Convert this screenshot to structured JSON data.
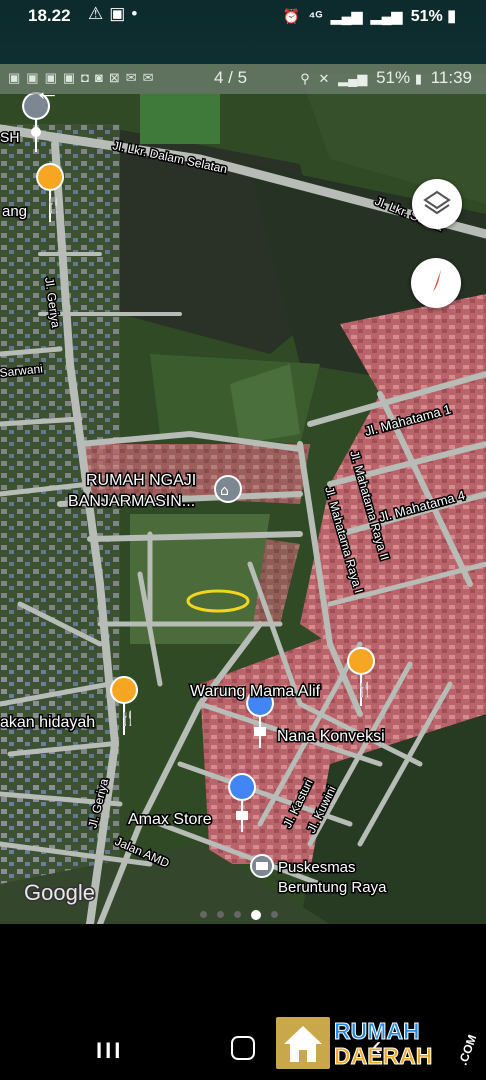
{
  "status_bar": {
    "time": "18.22",
    "left_icons": [
      "warning-icon",
      "image-icon",
      "dot-icon"
    ],
    "right_icons": [
      "alarm-icon",
      "network-4g-icon",
      "signal-icon",
      "signal-icon"
    ],
    "battery": "51%"
  },
  "viewer": {
    "page_counter": "4 / 5",
    "inner_battery": "51%",
    "inner_time": "11:39",
    "page_count": 5,
    "active_page": 4
  },
  "map": {
    "roads": {
      "lkr_dalam_selatan": "Jl. Lkr. Dalam Selatan",
      "lkr_selatan_edge": "Jl. Lkr. Selata",
      "geriya_top": "Jl. Geriya",
      "geriya_bottom": "Jl. Geriya",
      "sarwani": "Sarwani",
      "mahatama_1": "Jl. Mahatama 1",
      "mahatama_4": "Jl. Mahatama 4",
      "mahatama_raya_2": "Jl. Mahatama Raya II",
      "mahatama_raya_1": "Jl. Mahatama Raya I",
      "kasturi": "Jl. Kasturi",
      "kuwini": "Jl. Kuwini",
      "amd": "Jalan AMD"
    },
    "places": {
      "top_left_fragment": "SH",
      "ang_fragment": "ang",
      "rumah_ngaji_line1": "RUMAH NGAJI",
      "rumah_ngaji_line2": "BANJARMASIN...",
      "warung": "Warung Mama Alif",
      "hidayah": "akan hidayah",
      "nana": "Nana Konveksi",
      "amax": "Amax Store",
      "puskesmas_line1": "Puskesmas",
      "puskesmas_line2": "Beruntung Raya"
    },
    "attribution": "Google",
    "colors": {
      "restaurant_pin": "#f6a623",
      "place_pin": "#4285f4",
      "highlight_ellipse": "#f2d61b",
      "compass_red": "#e53935"
    }
  },
  "nav": {
    "recents_glyph": "III",
    "back_glyph": "‹"
  },
  "watermark": {
    "line1": "RUMAH",
    "line2": "DAERAH",
    "suffix": ".COM"
  }
}
